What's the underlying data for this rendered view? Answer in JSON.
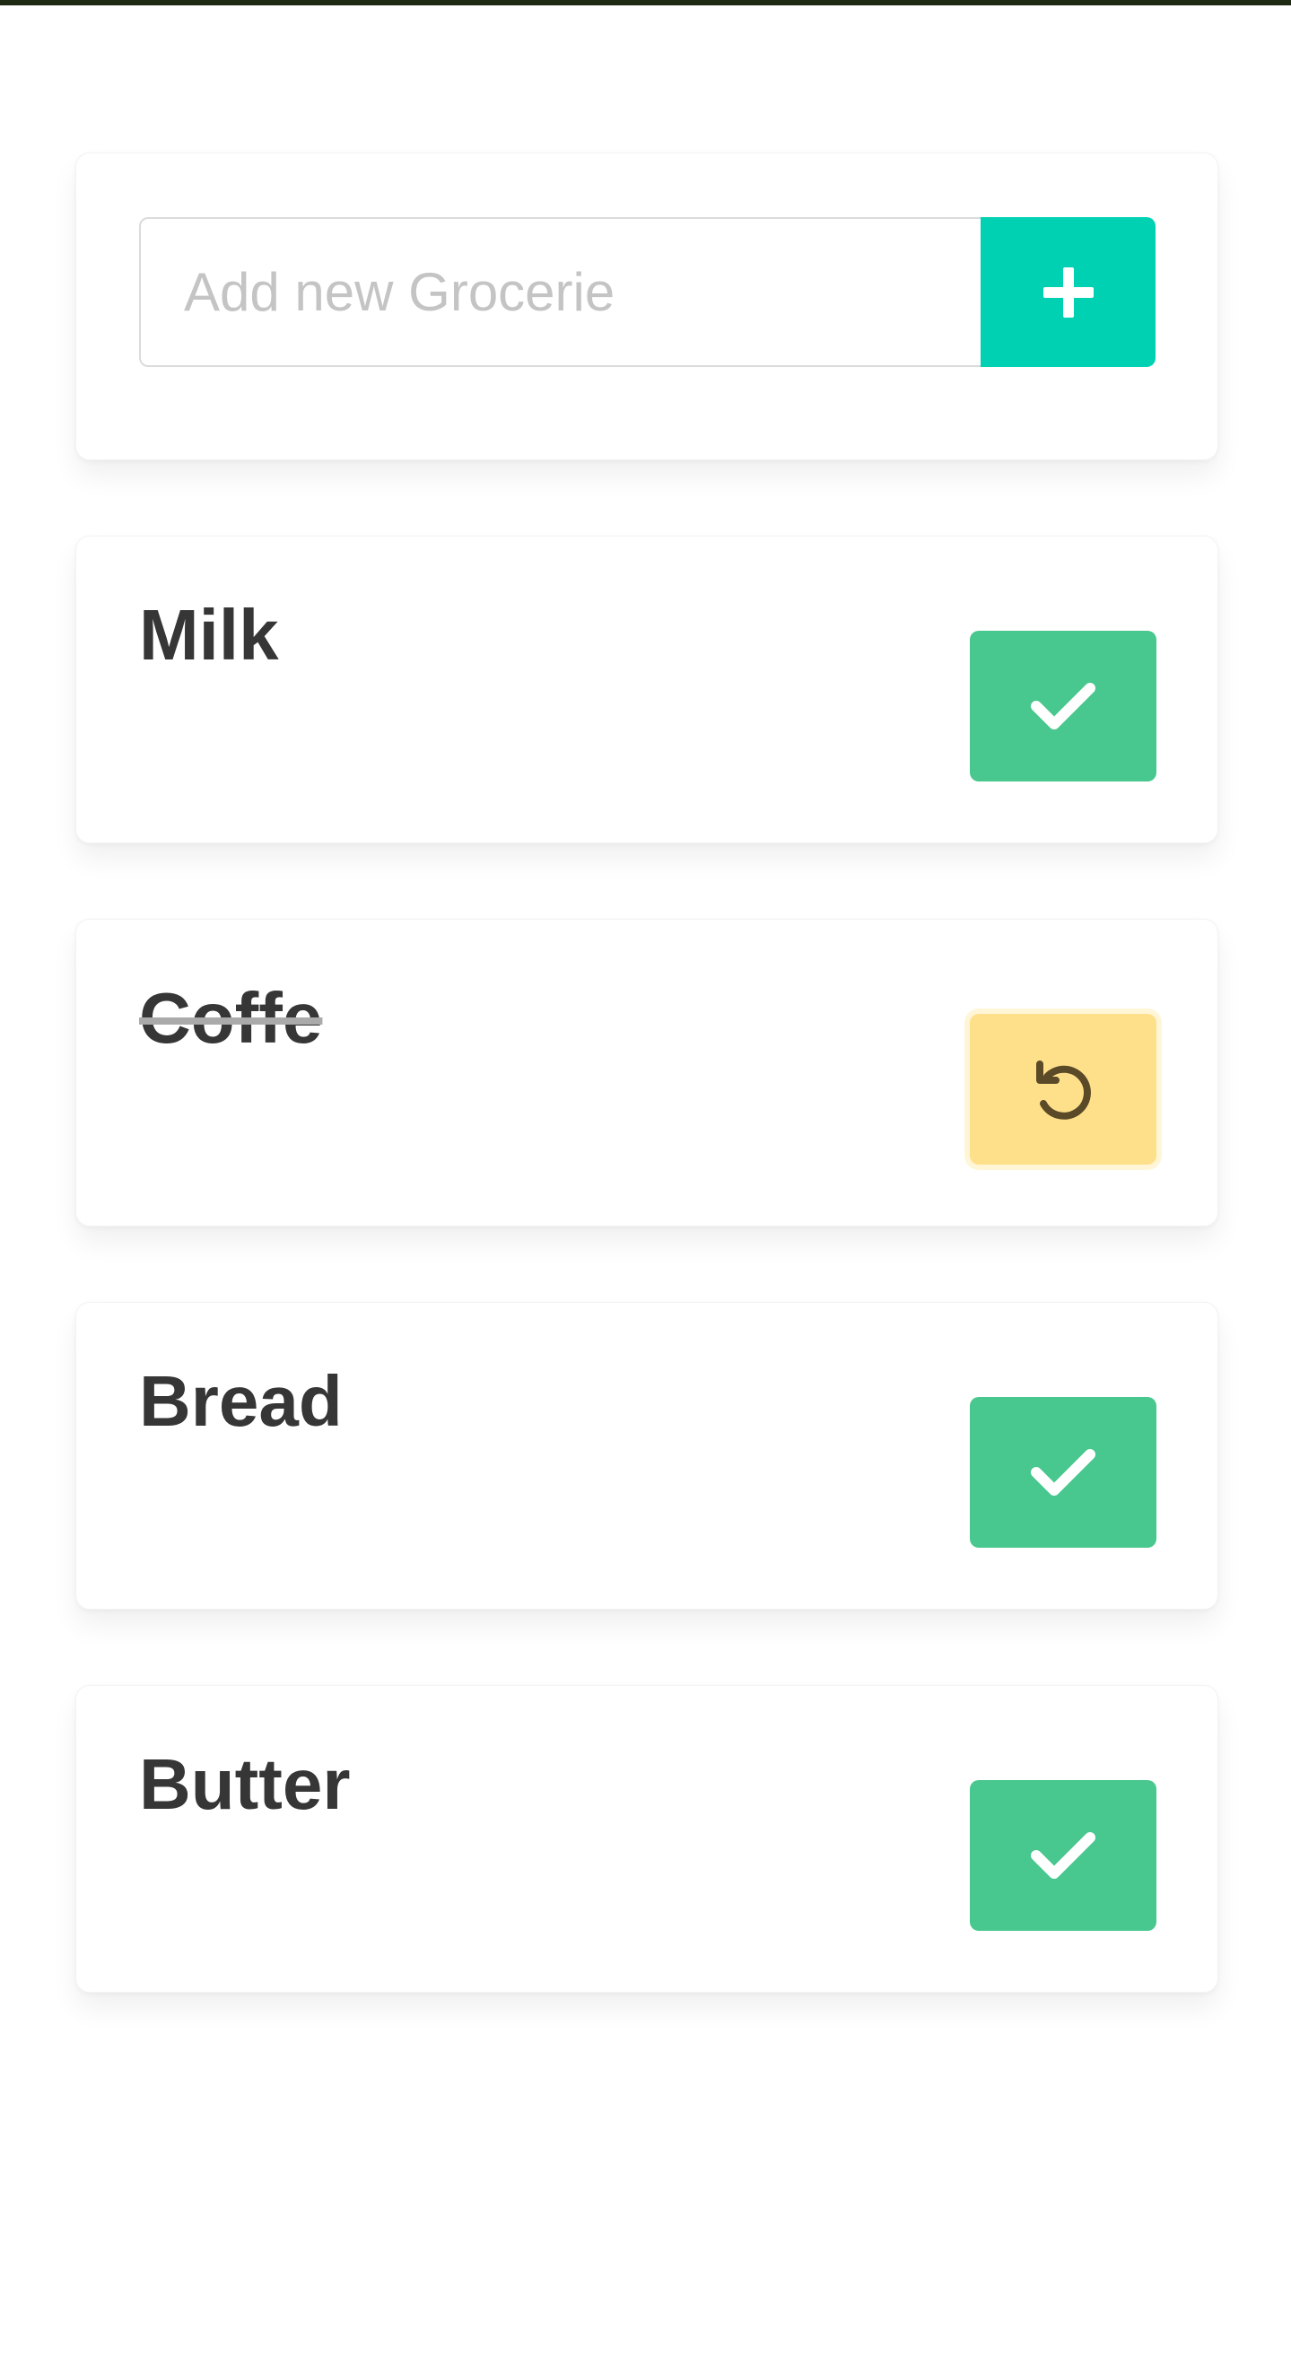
{
  "add_form": {
    "placeholder": "Add new Grocerie",
    "value": "",
    "add_icon": "plus-icon"
  },
  "items": [
    {
      "name": "Milk",
      "done": false,
      "action_icon": "check-icon"
    },
    {
      "name": "Coffe",
      "done": true,
      "action_icon": "undo-icon"
    },
    {
      "name": "Bread",
      "done": false,
      "action_icon": "check-icon"
    },
    {
      "name": "Butter",
      "done": false,
      "action_icon": "check-icon"
    }
  ],
  "colors": {
    "primary": "#00d1b2",
    "success": "#48c78e",
    "warning": "#ffe08a",
    "text": "#363636"
  }
}
